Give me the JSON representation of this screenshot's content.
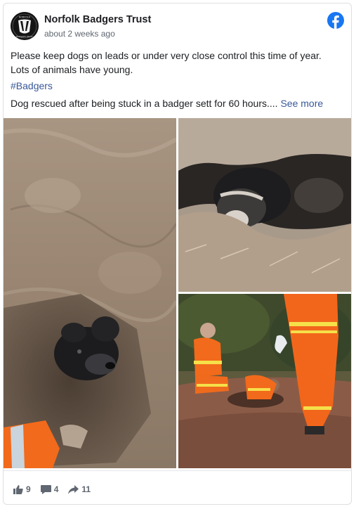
{
  "post": {
    "page_name": "Norfolk Badgers Trust",
    "timestamp": "about 2 weeks ago",
    "body": "Please keep dogs on leads or under very close control this time of year. Lots of animals have young.",
    "hashtag": "#Badgers",
    "excerpt": "Dog rescued after being stuck in a badger sett for 60 hours....",
    "see_more": "See more"
  },
  "avatar": {
    "icon": "badger-logo",
    "logo_text_top": "NORFOLK",
    "logo_text_bottom": "BADGERS TRUST"
  },
  "brand_icon": "facebook-icon",
  "photos": [
    {
      "name": "dog-in-sett-photo",
      "alt": "Dog's head emerging from a hole in dry soil"
    },
    {
      "name": "dog-under-earth-ledge-photo",
      "alt": "Dog lying under an overhanging earth ledge"
    },
    {
      "name": "rescue-team-photo",
      "alt": "Fire crew in orange suits digging at the sett"
    }
  ],
  "stats": {
    "likes": "9",
    "comments": "4",
    "shares": "11"
  },
  "colors": {
    "link": "#385898",
    "facebook_blue": "#1877f2",
    "muted": "#606770",
    "rescue_orange": "#f26a1b"
  }
}
